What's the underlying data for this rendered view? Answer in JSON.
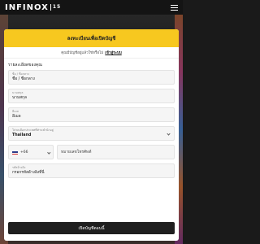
{
  "brand": {
    "logo_text": "INFINOX",
    "logo_badge": "15"
  },
  "header": {
    "title": "ลงทะเบียนเพื่อเปิดบัญชี"
  },
  "login": {
    "prompt": "คุณมีบัญชีอยู่แล้วใช่หรือไม่",
    "link": "เข้าสู่ระบบ"
  },
  "section": {
    "title": "รายละเอียดของคุณ"
  },
  "fields": {
    "first_name": {
      "label": "ชื่อ / ชื่อกลาง",
      "value": "ชื่อ / ชื่อกลาง"
    },
    "last_name": {
      "label": "นามสกุล",
      "value": "นามสกุล"
    },
    "email": {
      "label": "อีเมล",
      "value": "อีเมล"
    },
    "country": {
      "label": "โปรดเลือกประเทศที่ท่านพำนักอยู่",
      "value": "Thailand"
    },
    "phone_code": {
      "value": "+66"
    },
    "phone": {
      "value": "หมายเลขโทรศัพท์"
    },
    "referral": {
      "label": "รหัสอ้างอิง",
      "value": "กรอกรหัสอ้างอิงที่นี่"
    }
  },
  "submit": {
    "label": "เปิดบัญชีตอนนี้"
  },
  "colors": {
    "accent": "#f7c81f",
    "button": "#1f1f1f"
  }
}
